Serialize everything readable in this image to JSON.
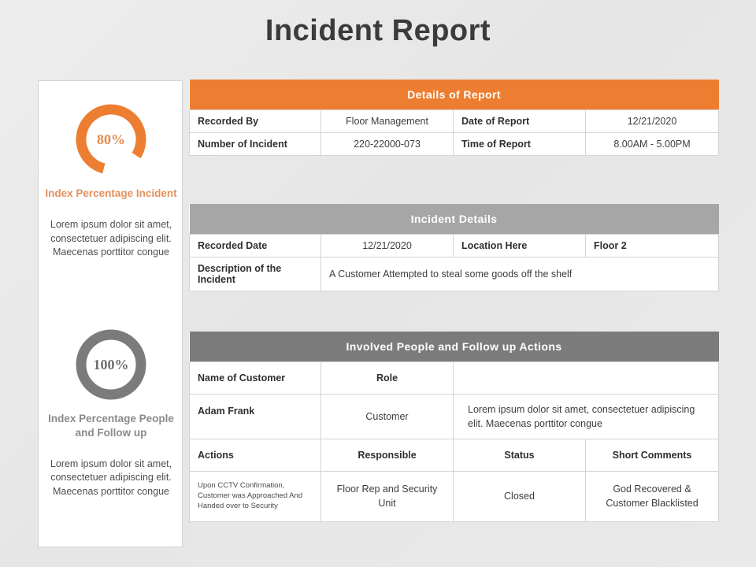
{
  "page": {
    "title": "Incident Report"
  },
  "theme": {
    "orange": "#ed7d31",
    "gray_light": "#a6a6a6",
    "gray_dark": "#7b7b7b",
    "orange_text": "#e3905e",
    "background": "#e9e9e9"
  },
  "sidebar": {
    "kpis": [
      {
        "value": "80%",
        "percent": 80,
        "color": "#ed7d31",
        "label": "Index Percentage Incident",
        "description": "Lorem ipsum dolor sit amet, consectetuer adipiscing elit. Maecenas porttitor congue"
      },
      {
        "value": "100%",
        "percent": 100,
        "color": "#7b7b7b",
        "label": "Index Percentage People and Follow up",
        "description": "Lorem ipsum dolor sit amet, consectetuer adipiscing elit. Maecenas porttitor congue"
      }
    ]
  },
  "tables": {
    "details_of_report": {
      "header": "Details of Report",
      "rows": [
        {
          "label_1": "Recorded By",
          "value_1": "Floor Management",
          "label_2": "Date of Report",
          "value_2": "12/21/2020"
        },
        {
          "label_1": "Number of Incident",
          "value_1": "220-22000-073",
          "label_2": "Time of Report",
          "value_2": "8.00AM - 5.00PM"
        }
      ]
    },
    "incident_details": {
      "header": "Incident Details",
      "row_1": {
        "label_1": "Recorded Date",
        "value_1": "12/21/2020",
        "label_2": "Location Here",
        "value_2": "Floor 2"
      },
      "row_2": {
        "label": "Description of the Incident",
        "value": "A Customer Attempted to steal some goods off the shelf"
      }
    },
    "involved_people": {
      "header": "Involved People and Follow up Actions",
      "person_header": {
        "col_1": "Name of Customer",
        "col_2": "Role",
        "col_3": ""
      },
      "person_row": {
        "col_1": "Adam Frank",
        "col_2": "Customer",
        "col_3": "Lorem ipsum dolor sit amet, consectetuer adipiscing elit. Maecenas porttitor congue"
      },
      "actions_header": {
        "col_1": "Actions",
        "col_2": "Responsible",
        "col_3": "Status",
        "col_4": "Short Comments"
      },
      "actions_row": {
        "col_1": "Upon CCTV Confirmation, Customer was Approached And Handed over to Security",
        "col_2": "Floor Rep and Security Unit",
        "col_3": "Closed",
        "col_4": "God Recovered & Customer Blacklisted"
      }
    }
  }
}
